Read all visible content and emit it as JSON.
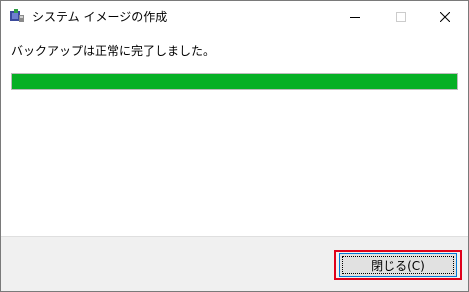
{
  "window": {
    "title": "システム イメージの作成",
    "controls": {
      "minimize": "minimize-icon",
      "maximize": "maximize-icon",
      "close": "close-icon"
    }
  },
  "content": {
    "message": "バックアップは正常に完了しました。",
    "progress": {
      "value_percent": 100,
      "color": "#06b025"
    }
  },
  "footer": {
    "close_button_label": "閉じる(C)"
  },
  "colors": {
    "accent": "#0078d7",
    "highlight": "#e0001a",
    "progress": "#06b025"
  }
}
